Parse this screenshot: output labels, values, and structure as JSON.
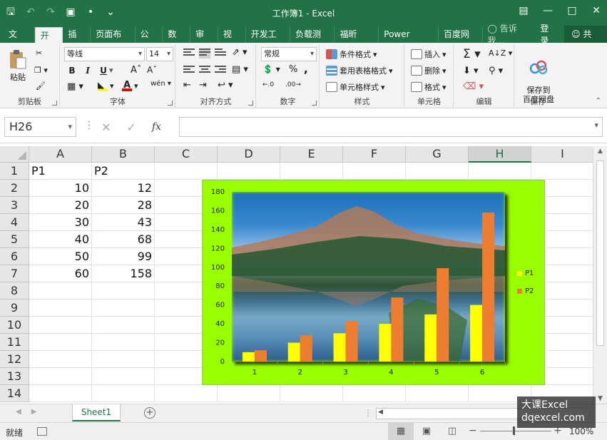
{
  "window": {
    "title": "工作簿1 - Excel",
    "qat_icons": [
      "save-icon",
      "undo-icon",
      "redo-icon",
      "camera-icon",
      "touch-mode-icon",
      "customize-qat-icon"
    ],
    "controls": [
      "ribbon-display-options-icon",
      "minimize-icon",
      "maximize-icon",
      "close-icon"
    ]
  },
  "tabs": [
    "文件",
    "开始",
    "插入",
    "页面布局",
    "公式",
    "数据",
    "审阅",
    "视图",
    "开发工具",
    "负载测试",
    "福昕PDF",
    "Power Pivot",
    "百度网盘"
  ],
  "active_tab": "开始",
  "tell_me": "告诉我...",
  "login": "登录",
  "share": "共享",
  "ribbon": {
    "clipboard": {
      "label": "剪贴板",
      "paste": "粘贴"
    },
    "font": {
      "label": "字体",
      "font_name": "等线",
      "font_size": "14",
      "bold": "B",
      "italic": "I",
      "underline": "U"
    },
    "alignment": {
      "label": "对齐方式"
    },
    "number": {
      "label": "数字",
      "format": "常规",
      "percent": "%",
      "comma": ","
    },
    "styles": {
      "label": "样式",
      "conditional": "条件格式",
      "table": "套用表格格式",
      "cell": "单元格样式"
    },
    "cells": {
      "label": "单元格",
      "insert": "插入",
      "delete": "删除",
      "format": "格式"
    },
    "editing": {
      "label": "编辑"
    },
    "save": {
      "label": "保存",
      "button": "保存到\n百度网盘"
    }
  },
  "formula_bar": {
    "name_box": "H26",
    "fx": "fx",
    "value": ""
  },
  "columns": [
    "A",
    "B",
    "C",
    "D",
    "E",
    "F",
    "G",
    "H",
    "I"
  ],
  "selected_column": "H",
  "rows": [
    "1",
    "2",
    "3",
    "4",
    "5",
    "6",
    "7",
    "8",
    "9",
    "10",
    "11",
    "12",
    "13",
    "14"
  ],
  "cells": {
    "A1": "P1",
    "B1": "P2",
    "A2": "10",
    "B2": "12",
    "A3": "20",
    "B3": "28",
    "A4": "30",
    "B4": "43",
    "A5": "40",
    "B5": "68",
    "A6": "50",
    "B6": "99",
    "A7": "60",
    "B7": "158"
  },
  "chart_data": {
    "type": "bar",
    "categories": [
      "1",
      "2",
      "3",
      "4",
      "5",
      "6"
    ],
    "series": [
      {
        "name": "P1",
        "values": [
          10,
          20,
          30,
          40,
          50,
          60
        ],
        "color": "#ffff00"
      },
      {
        "name": "P2",
        "values": [
          12,
          28,
          43,
          68,
          99,
          158
        ],
        "color": "#ed7d31"
      }
    ],
    "ylim": [
      0,
      180
    ],
    "yticks": [
      "0",
      "20",
      "40",
      "60",
      "80",
      "100",
      "120",
      "140",
      "160",
      "180"
    ],
    "legend_position": "right",
    "background": "#99ff00",
    "plot_area_fill": "landscape photo (mountain lake)",
    "grid": false
  },
  "sheet_tab": "Sheet1",
  "status": {
    "ready": "就绪",
    "zoom": "100%"
  },
  "watermark": {
    "line1": "大课Excel",
    "line2": "dqexcel.com"
  },
  "colors": {
    "brand": "#217346",
    "p1": "#ffff00",
    "p2": "#ed7d31",
    "chart_bg": "#99ff00"
  }
}
